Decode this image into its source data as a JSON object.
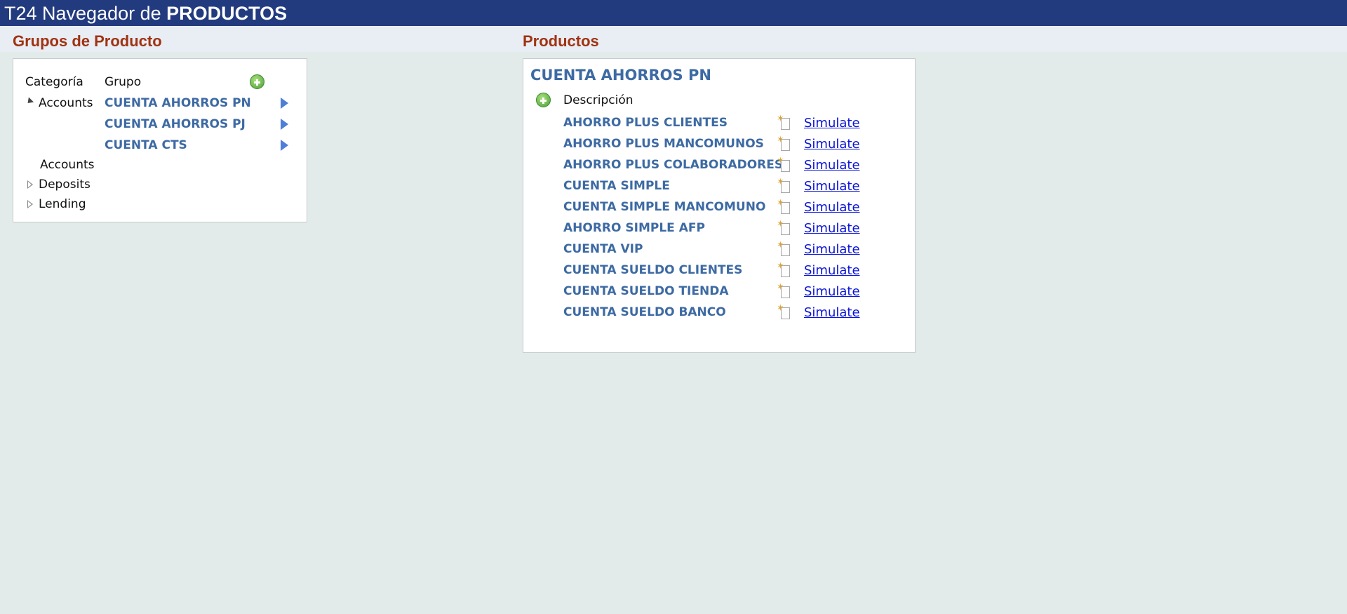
{
  "header": {
    "title_prefix": "T24 Navegador de ",
    "title_strong": "PRODUCTOS"
  },
  "groups": {
    "title": "Grupos de Producto",
    "col_category": "Categoría",
    "col_group": "Grupo",
    "expanded_category": "Accounts",
    "items": [
      {
        "label": "CUENTA AHORROS PN"
      },
      {
        "label": "CUENTA AHORROS PJ"
      },
      {
        "label": "CUENTA CTS"
      }
    ],
    "sub_label": "Accounts",
    "collapsed": [
      {
        "label": "Deposits"
      },
      {
        "label": "Lending"
      }
    ]
  },
  "products": {
    "title": "Productos",
    "group_title": "CUENTA AHORROS PN",
    "col_description": "Descripción",
    "simulate_label": "Simulate",
    "rows": [
      {
        "label": "AHORRO PLUS CLIENTES"
      },
      {
        "label": "AHORRO PLUS MANCOMUNOS"
      },
      {
        "label": "AHORRO PLUS COLABORADORES"
      },
      {
        "label": "CUENTA SIMPLE"
      },
      {
        "label": "CUENTA SIMPLE MANCOMUNO"
      },
      {
        "label": "AHORRO SIMPLE AFP"
      },
      {
        "label": "CUENTA VIP"
      },
      {
        "label": "CUENTA SUELDO CLIENTES"
      },
      {
        "label": "CUENTA SUELDO TIENDA"
      },
      {
        "label": "CUENTA SUELDO BANCO"
      }
    ]
  },
  "colors": {
    "header_bg": "#223a7e",
    "section_title": "#a03312",
    "product_text": "#3d6aa3",
    "link": "#0a14d8",
    "page_bg": "#e2ebe9"
  }
}
